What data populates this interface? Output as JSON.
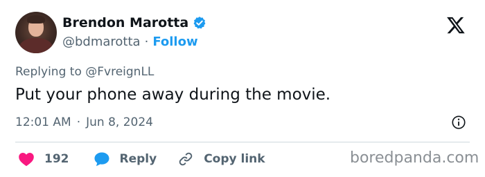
{
  "author": {
    "name": "Brendon Marotta",
    "handle": "@bdmarotta",
    "separator": "·",
    "follow_label": "Follow"
  },
  "tweet": {
    "replying_to": "Replying to @FvreignLL",
    "text": "Put your phone away during the movie.",
    "time": "12:01 AM",
    "meta_separator": "·",
    "date": "Jun 8, 2024"
  },
  "actions": {
    "like_count": "192",
    "reply_label": "Reply",
    "copy_link_label": "Copy link"
  },
  "watermark": "boredpanda.com",
  "colors": {
    "accent": "#1d9bf0",
    "like": "#f91880",
    "text": "#0f1419",
    "muted": "#536471"
  },
  "icons": [
    "verified-badge-icon",
    "x-logo-icon",
    "info-icon",
    "heart-icon",
    "reply-bubble-icon",
    "link-icon"
  ]
}
